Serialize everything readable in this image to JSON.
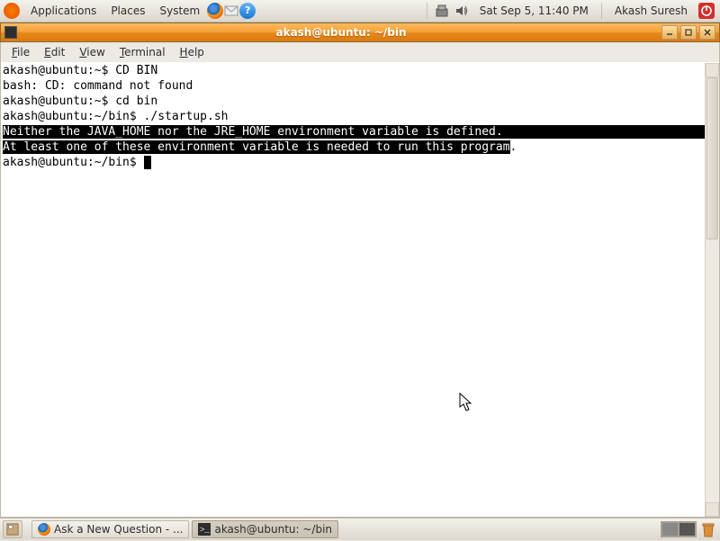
{
  "top_panel": {
    "menus": [
      "Applications",
      "Places",
      "System"
    ],
    "clock": "Sat Sep  5, 11:40 PM",
    "user": "Akash Suresh"
  },
  "window": {
    "title": "akash@ubuntu: ~/bin",
    "menubar": [
      "File",
      "Edit",
      "View",
      "Terminal",
      "Help"
    ]
  },
  "terminal": {
    "lines": [
      {
        "prompt": "akash@ubuntu:~$ ",
        "cmd": "CD BIN"
      },
      {
        "text": "bash: CD: command not found"
      },
      {
        "prompt": "akash@ubuntu:~$ ",
        "cmd": "cd bin"
      },
      {
        "prompt": "akash@ubuntu:~/bin$ ",
        "cmd": "./startup.sh"
      },
      {
        "text": "Neither the JAVA_HOME nor the JRE_HOME environment variable is defined.",
        "selected": true,
        "trailing_sel_pad": "                                                   "
      },
      {
        "text": "At least one of these environment variable is needed to run this program",
        "selected": true,
        "tail": "."
      },
      {
        "prompt": "akash@ubuntu:~/bin$ ",
        "cursor": true
      }
    ]
  },
  "taskbar": {
    "tasks": [
      {
        "label": "Ask a New Question - ...",
        "icon": "firefox",
        "active": false
      },
      {
        "label": "akash@ubuntu: ~/bin",
        "icon": "terminal",
        "active": true
      }
    ]
  }
}
